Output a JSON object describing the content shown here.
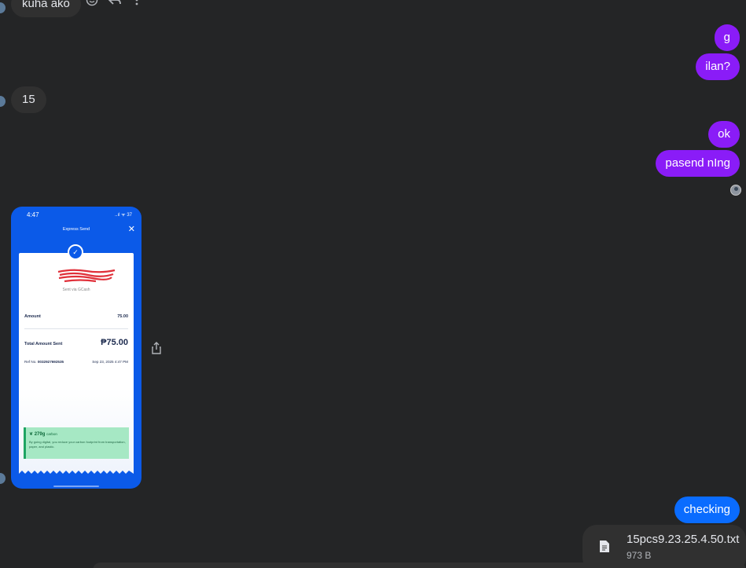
{
  "messages": {
    "in_1": "kuha ako",
    "out_g": "g",
    "out_ilan": "ilan?",
    "in_15": "15",
    "out_ok": "ok",
    "out_pasend": "pasend nIng",
    "out_checking": "checking"
  },
  "receipt": {
    "time": "4:47",
    "signal": "..ıl ᯤ 37",
    "title": "Express Send",
    "sent_via": "Sent via GCash",
    "amount_label": "Amount",
    "amount_value": "75.00",
    "total_label": "Total Amount Sent",
    "total_value": "₱75.00",
    "ref_label": "Ref No.",
    "ref_no": "0032927692535",
    "date": "Sep 23, 2025 4:47 PM",
    "green_title": "279g",
    "green_unit": "carbon",
    "green_desc": "By going digital, you reduce your carbon footprint from transportation, paper, and plastic."
  },
  "attachment": {
    "filename": "15pcs9.23.25.4.50.txt",
    "size": "973 B"
  },
  "colors": {
    "background": "#242526",
    "outgoing": "#8a1cf7",
    "outgoing_blue": "#0a6cff",
    "incoming": "#303030"
  }
}
